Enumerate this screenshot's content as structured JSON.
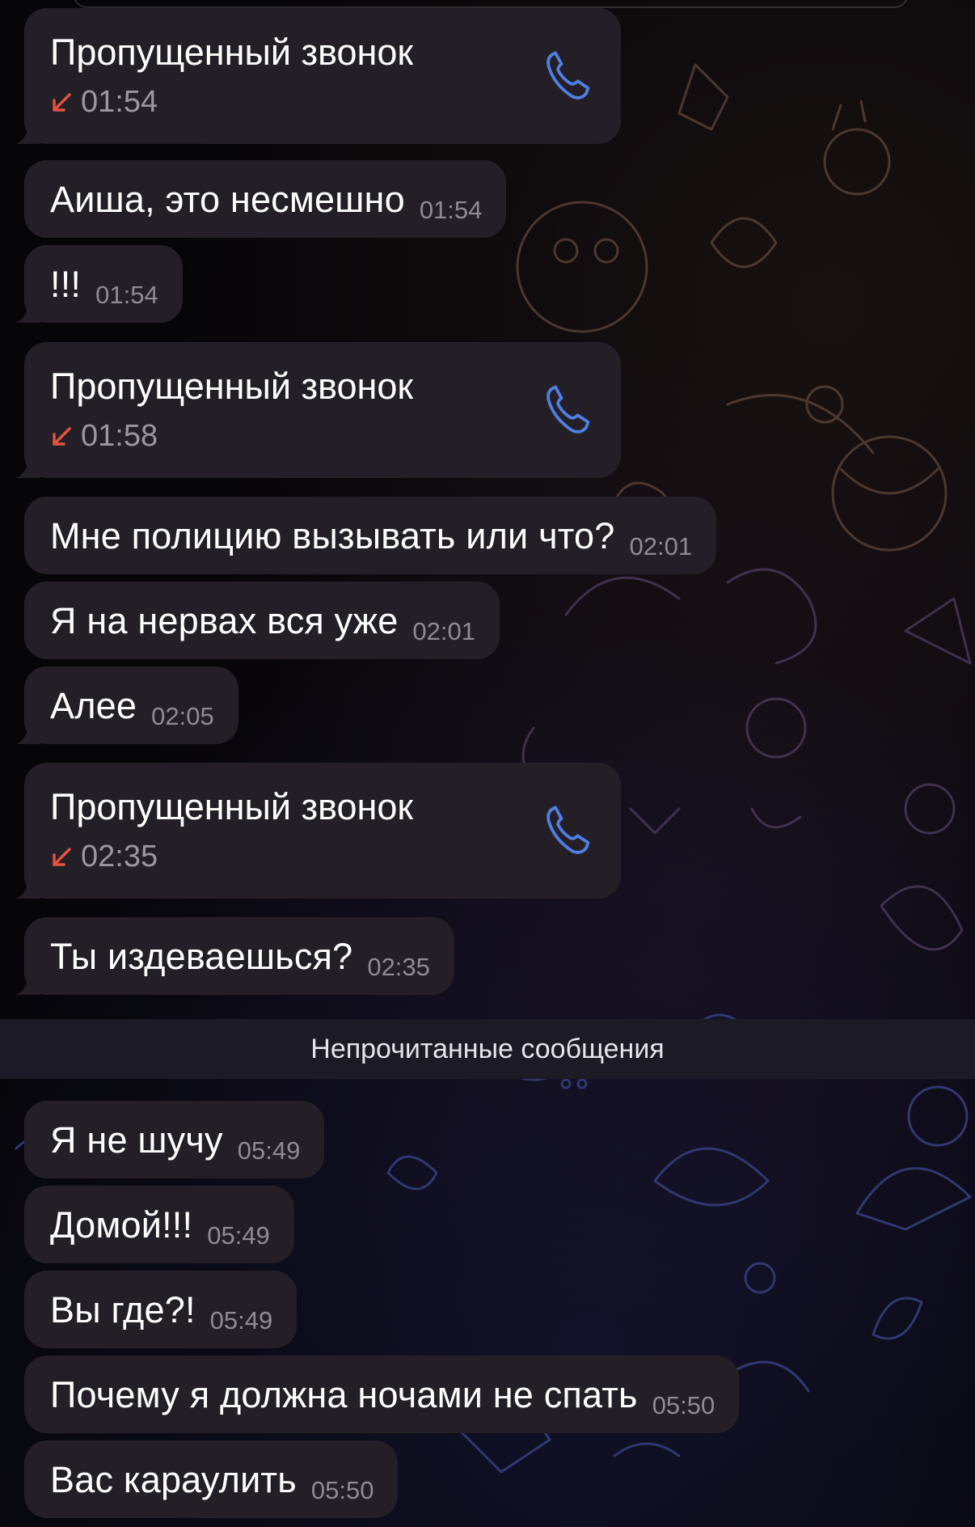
{
  "colors": {
    "bubble": "#241f27",
    "time": "#8f8a94",
    "missed_arrow": "#e5533d",
    "phone_icon": "#4f7fe0",
    "divider_bg": "#1c1a24"
  },
  "messages": [
    {
      "type": "call",
      "title": "Пропущенный звонок",
      "time": "01:54"
    },
    {
      "type": "text",
      "text": "Аиша, это несмешно",
      "time": "01:54"
    },
    {
      "type": "text",
      "text": "!!!",
      "time": "01:54"
    },
    {
      "type": "call",
      "title": "Пропущенный звонок",
      "time": "01:58"
    },
    {
      "type": "text",
      "text": "Мне полицию вызывать или что?",
      "time": "02:01"
    },
    {
      "type": "text",
      "text": "Я на нервах вся уже",
      "time": "02:01"
    },
    {
      "type": "text",
      "text": "Алее",
      "time": "02:05"
    },
    {
      "type": "call",
      "title": "Пропущенный звонок",
      "time": "02:35"
    },
    {
      "type": "text",
      "text": "Ты издеваешься?",
      "time": "02:35"
    }
  ],
  "unread_divider": "Непрочитанные сообщения",
  "unread_messages": [
    {
      "text": "Я не шучу",
      "time": "05:49"
    },
    {
      "text": "Домой!!!",
      "time": "05:49"
    },
    {
      "text": "Вы где?!",
      "time": "05:49"
    },
    {
      "text": "Почему я должна ночами не спать",
      "time": "05:50"
    },
    {
      "text": "Вас караулить",
      "time": "05:50"
    }
  ]
}
